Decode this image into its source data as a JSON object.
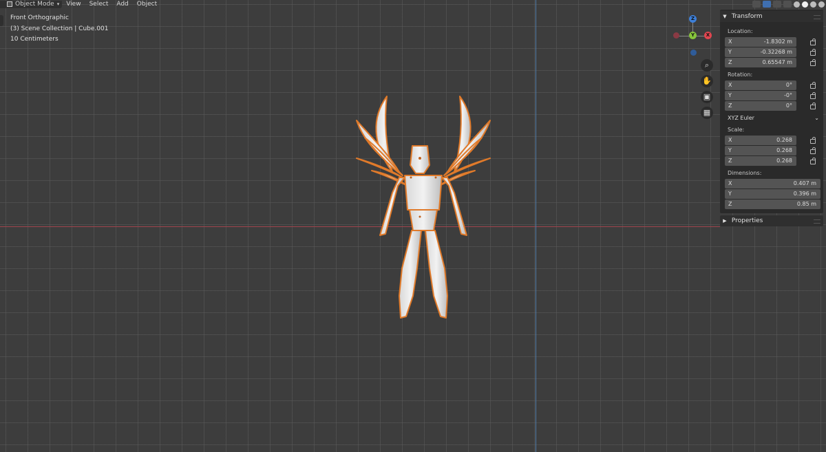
{
  "header": {
    "mode": "Object Mode",
    "menu": [
      "View",
      "Select",
      "Add",
      "Object"
    ]
  },
  "overlay": {
    "view_name": "Front Orthographic",
    "collection": "(3) Scene Collection | Cube.001",
    "units": "10 Centimeters"
  },
  "gizmo": {
    "z_label": "Z",
    "y_label": "Y",
    "x_label": "X",
    "x_color": "#e0454f",
    "y_color": "#86c43b",
    "z_color": "#3d7fd8"
  },
  "nav_buttons": [
    "zoom-icon",
    "hand-pan-icon",
    "camera-icon",
    "grid-icon"
  ],
  "sidebar": {
    "transform_title": "Transform",
    "location_label": "Location:",
    "location": [
      {
        "axis": "X",
        "value": "-1.8302 m"
      },
      {
        "axis": "Y",
        "value": "-0.32268 m"
      },
      {
        "axis": "Z",
        "value": "0.65547 m"
      }
    ],
    "rotation_label": "Rotation:",
    "rotation": [
      {
        "axis": "X",
        "value": "0°"
      },
      {
        "axis": "Y",
        "value": "-0°"
      },
      {
        "axis": "Z",
        "value": "0°"
      }
    ],
    "rotation_mode": "XYZ Euler",
    "scale_label": "Scale:",
    "scale": [
      {
        "axis": "X",
        "value": "0.268"
      },
      {
        "axis": "Y",
        "value": "0.268"
      },
      {
        "axis": "Z",
        "value": "0.268"
      }
    ],
    "dimensions_label": "Dimensions:",
    "dimensions": [
      {
        "axis": "X",
        "value": "0.407 m"
      },
      {
        "axis": "Y",
        "value": "0.396 m"
      },
      {
        "axis": "Z",
        "value": "0.85 m"
      }
    ]
  },
  "properties_panel": {
    "title": "Properties"
  },
  "colors": {
    "background": "#3d3d3d",
    "selection_outline": "#e07a2a",
    "x_axis_line": "#a0434d",
    "z_axis_line": "#4f7aa6"
  }
}
